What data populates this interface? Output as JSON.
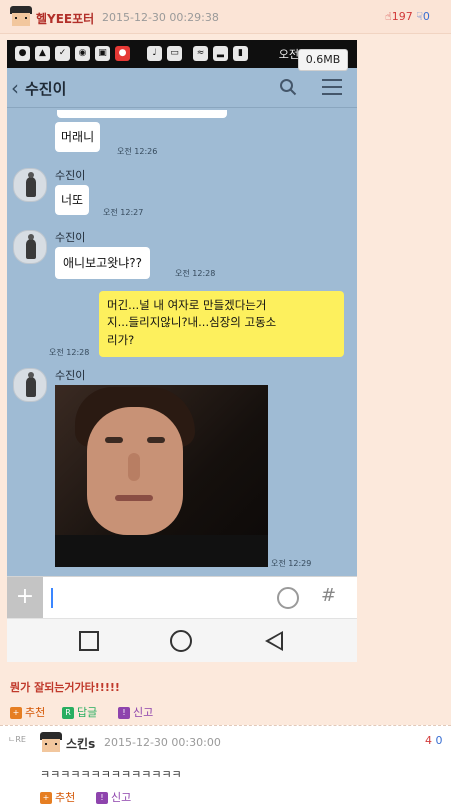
{
  "post": {
    "nickname": "헬YEE포터",
    "date": "2015-12-30 00:29:38",
    "votes_up": "197",
    "votes_down": "0"
  },
  "phone": {
    "statusbar_icons": [
      "icon-1",
      "icon-2",
      "icon-3",
      "icon-4",
      "icon-5",
      "icon-6"
    ],
    "status_text": "오전",
    "image_size": "0.6MB",
    "room_title": "수진이",
    "messages": [
      {
        "sender": "",
        "text": "머래니",
        "time": "오전 12:26",
        "side": "left"
      },
      {
        "sender": "수진이",
        "text": "너또",
        "time": "오전 12:27",
        "side": "left"
      },
      {
        "sender": "수진이",
        "text": "애니보고왓냐??",
        "time": "오전 12:28",
        "side": "left"
      },
      {
        "sender": "",
        "text_lines": [
          "머긴...널 내 여자로 만들겠다는거",
          "지...들리지않니?내...심장의 고동소",
          "리가?"
        ],
        "time": "오전 12:28",
        "side": "right"
      },
      {
        "sender": "수진이",
        "text": "",
        "time": "오전 12:29",
        "side": "left",
        "attachment": "photo"
      }
    ]
  },
  "post_body": "뭔가 잘되는거가타!!!!!",
  "actions": {
    "recommend_label": "추천",
    "reply_label": "답글",
    "report_label": "신고"
  },
  "comment": {
    "nickname": "스킨s",
    "date": "2015-12-30 00:30:00",
    "votes_up": "4",
    "votes_down": "0",
    "reply_marker": "ㄴRE",
    "text": "ㅋㅋㅋㅋㅋㅋㅋㅋㅋㅋㅋㅋㅋㅋ",
    "recommend_label": "추천",
    "report_label": "신고"
  }
}
